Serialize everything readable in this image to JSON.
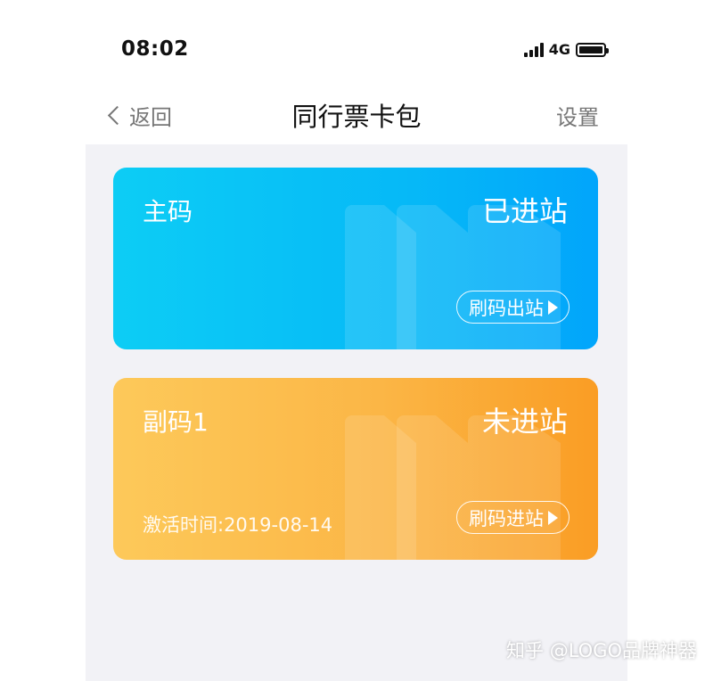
{
  "status_bar": {
    "time": "08:02",
    "network": "4G",
    "signal_bars": 4,
    "battery_level": 1.0
  },
  "nav": {
    "back_label": "返回",
    "title": "同行票卡包",
    "settings_label": "设置"
  },
  "cards": [
    {
      "title": "主码",
      "status": "已进站",
      "action_label": "刷码出站",
      "accent": "#06b9f7"
    },
    {
      "title": "副码1",
      "status": "未进站",
      "action_label": "刷码进站",
      "date_text": "激活时间:2019-08-14",
      "accent": "#fbb646"
    }
  ],
  "watermark": "知乎 @LOGO品牌神器",
  "colors": {
    "background": "#f2f2f6",
    "main_card": "#06b9f7",
    "sub_card": "#fbb646"
  }
}
